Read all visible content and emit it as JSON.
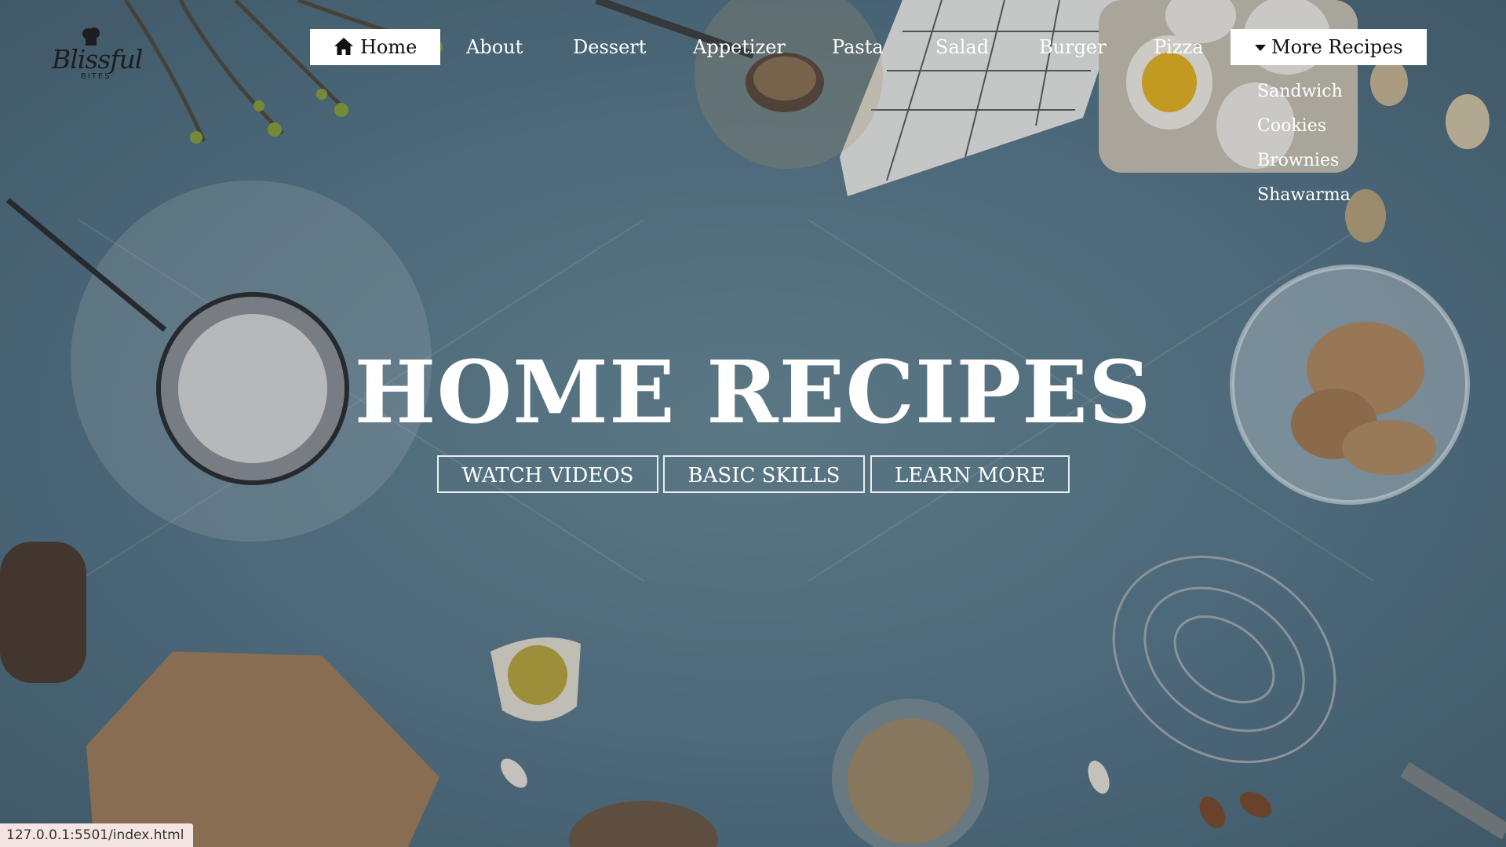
{
  "logo": {
    "name": "Blissful",
    "sub": "BITES"
  },
  "nav": {
    "home": "Home",
    "about": "About",
    "dessert": "Dessert",
    "appetizer": "Appetizer",
    "pasta": "Pasta",
    "salad": "Salad",
    "burger": "Burger",
    "pizza": "Pizza",
    "more": "More Recipes"
  },
  "dropdown": [
    "Sandwich",
    "Cookies",
    "Brownies",
    "Shawarma"
  ],
  "hero": {
    "title": "HOME RECIPES",
    "buttons": [
      "WATCH VIDEOS",
      "BASIC SKILLS",
      "LEARN MORE"
    ]
  },
  "status_bar": "127.0.0.1:5501/index.html",
  "colors": {
    "background": "#5c7c8c",
    "text": "#ffffff",
    "active_nav": "#ffffff"
  },
  "icons": {
    "home": "home-icon",
    "caret": "caret-down-icon"
  }
}
